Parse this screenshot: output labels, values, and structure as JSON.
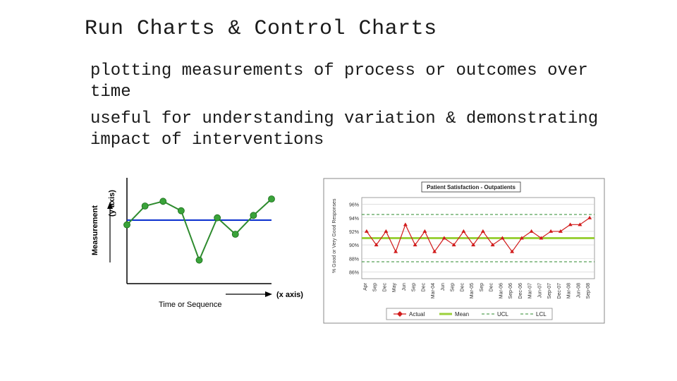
{
  "title": "Run Charts & Control Charts",
  "body_line1": "plotting measurements of process or outcomes over time",
  "body_line2": "useful for understanding variation & demonstrating impact of interventions",
  "chart_data": [
    {
      "type": "line",
      "name": "Run Chart",
      "xlabel": "Time or Sequence",
      "xlabel_note": "(x axis)",
      "ylabel": "Measurement",
      "ylabel_note": "(y axis)",
      "x": [
        1,
        2,
        3,
        4,
        5,
        6,
        7,
        8,
        9
      ],
      "values": [
        5.0,
        5.8,
        6.0,
        5.6,
        3.5,
        5.3,
        4.6,
        5.4,
        6.1
      ],
      "median": 5.2,
      "ylim": [
        2.5,
        7.0
      ]
    },
    {
      "type": "line",
      "name": "Control Chart",
      "title": "Patient Satisfaction - Outpatients",
      "ylabel": "% Good or Very Good Responses",
      "categories": [
        "Apr",
        "Sep",
        "Dec",
        "May",
        "Jun",
        "Sep",
        "Dec",
        "Mar-04",
        "Jun",
        "Sep",
        "Dec",
        "Mar-05",
        "Sep",
        "Dec",
        "Mar-06",
        "Sep-06",
        "Dec-06",
        "Mar-07",
        "Jun-07",
        "Sep-07",
        "Dec-07",
        "Mar-08",
        "Jun-08",
        "Sep-08"
      ],
      "series": [
        {
          "name": "Actual",
          "values": [
            92,
            90,
            92,
            89,
            93,
            90,
            92,
            89,
            91,
            90,
            92,
            90,
            92,
            90,
            91,
            89,
            91,
            92,
            91,
            92,
            92,
            93,
            93,
            94
          ]
        },
        {
          "name": "Mean",
          "value": 91
        },
        {
          "name": "UCL",
          "value": 94.5
        },
        {
          "name": "LCL",
          "value": 87.5
        }
      ],
      "yticks": [
        86,
        88,
        90,
        92,
        94,
        96
      ],
      "ylim": [
        85,
        97
      ],
      "legend": [
        "Actual",
        "Mean",
        "UCL",
        "LCL"
      ]
    }
  ]
}
